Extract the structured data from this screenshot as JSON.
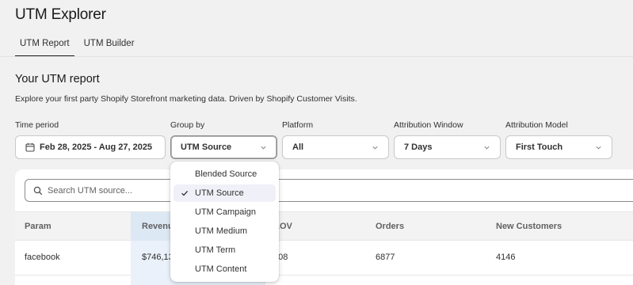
{
  "app": {
    "title": "UTM Explorer"
  },
  "tabs": [
    {
      "label": "UTM Report",
      "active": true
    },
    {
      "label": "UTM Builder",
      "active": false
    }
  ],
  "report": {
    "title": "Your UTM report",
    "description": "Explore your first party Shopify Storefront marketing data. Driven by Shopify Customer Visits."
  },
  "filters": {
    "time_period": {
      "label": "Time period",
      "value": "Feb 28, 2025 - Aug 27, 2025",
      "icon": "calendar-icon"
    },
    "group_by": {
      "label": "Group by",
      "value": "UTM Source"
    },
    "platform": {
      "label": "Platform",
      "value": "All"
    },
    "attribution_window": {
      "label": "Attribution Window",
      "value": "7 Days"
    },
    "attribution_model": {
      "label": "Attribution Model",
      "value": "First Touch"
    }
  },
  "dropdown": {
    "options": [
      "Blended Source",
      "UTM Source",
      "UTM Campaign",
      "UTM Medium",
      "UTM Term",
      "UTM Content"
    ],
    "selected": "UTM Source"
  },
  "search": {
    "placeholder": "Search UTM source..."
  },
  "table": {
    "columns": [
      "Param",
      "Revenue",
      "AOV",
      "Orders",
      "New Customers"
    ],
    "rows": [
      [
        "facebook",
        "$746,13",
        "108",
        "6877",
        "4146"
      ]
    ]
  },
  "colors": {
    "highlight_column": "#dde8f5",
    "selected_option_bg": "#f0f0f8"
  }
}
